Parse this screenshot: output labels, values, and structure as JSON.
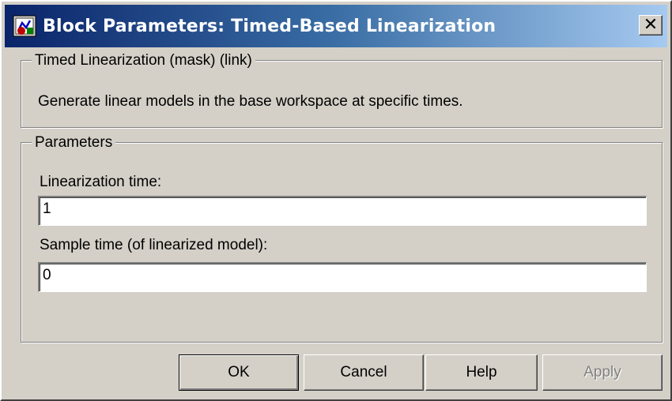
{
  "window": {
    "title": "Block Parameters: Timed-Based Linearization"
  },
  "description_group": {
    "legend": "Timed Linearization (mask) (link)",
    "text": "Generate linear models in the base workspace at specific times."
  },
  "parameters_group": {
    "legend": "Parameters",
    "linearization_time_label": "Linearization time:",
    "linearization_time_value": "1",
    "sample_time_label": "Sample time (of linearized model):",
    "sample_time_value": "0"
  },
  "buttons": {
    "ok": "OK",
    "cancel": "Cancel",
    "help": "Help",
    "apply": "Apply"
  },
  "icons": {
    "title_icon": "simulink-block-icon",
    "close_icon": "close-icon",
    "close_glyph": "✕"
  },
  "colors": {
    "titlebar_start": "#0a246a",
    "titlebar_end": "#a6caf0",
    "face": "#d4d0c8"
  }
}
